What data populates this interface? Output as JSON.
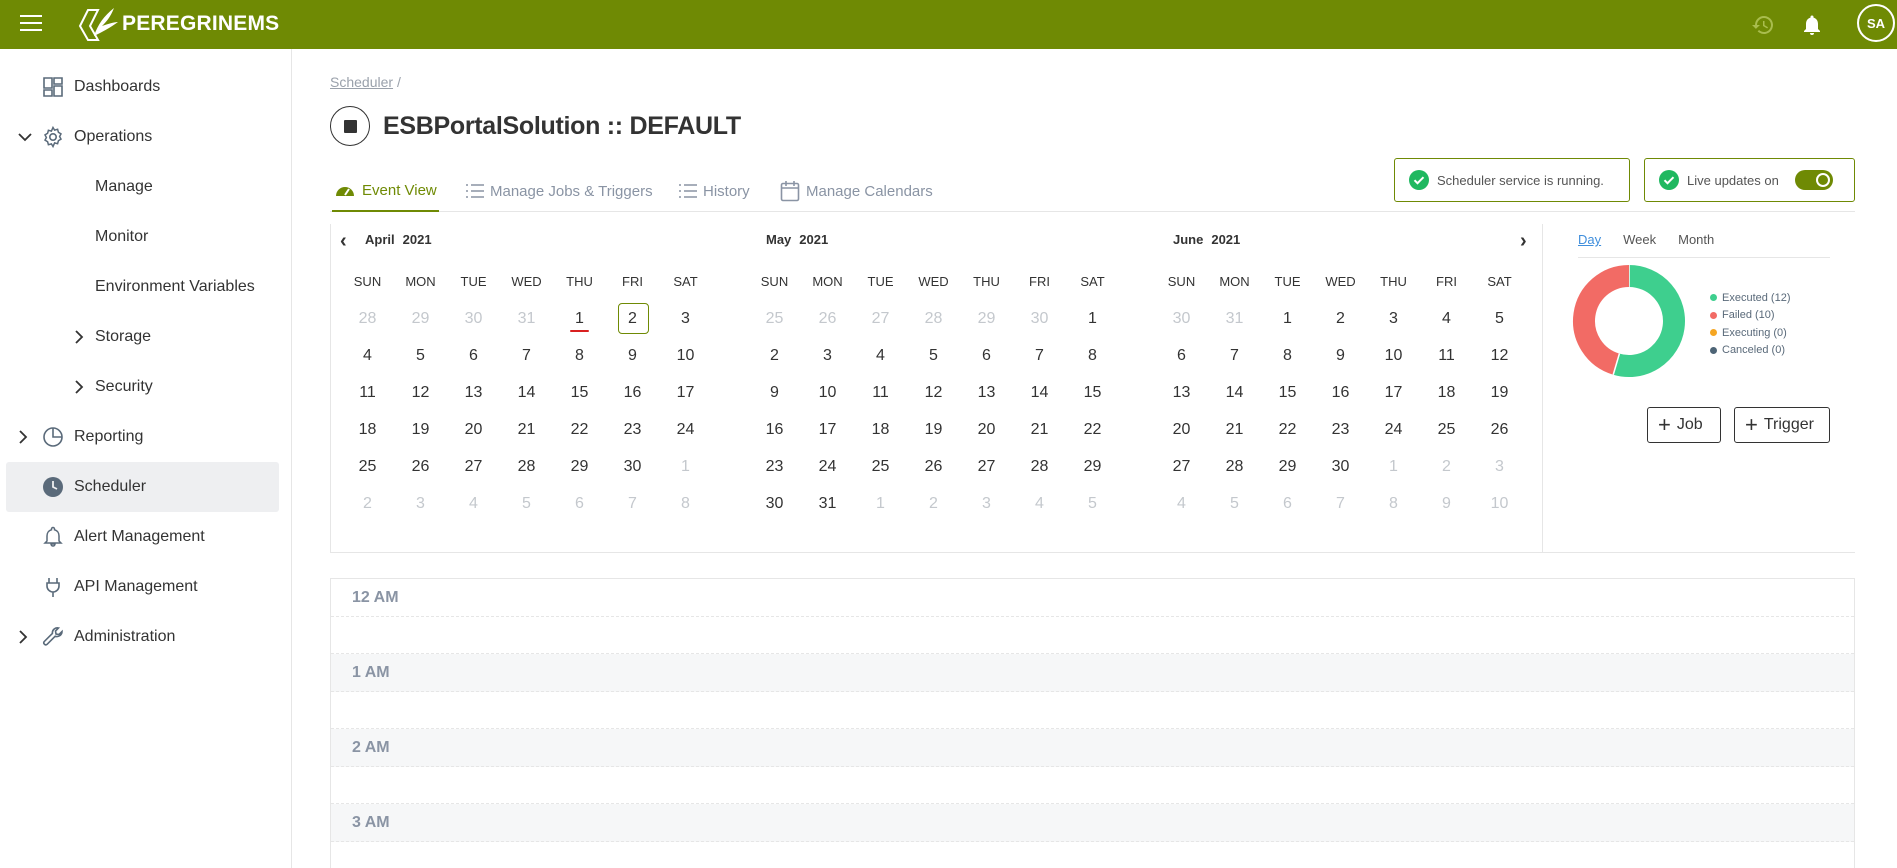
{
  "topbar": {
    "brand": "PEREGRINEMS",
    "avatar_initials": "SA",
    "icons": [
      "menu-icon",
      "history-icon",
      "bell-icon"
    ],
    "color": "#6f8a04"
  },
  "sidebar": {
    "items": [
      {
        "label": "Dashboards",
        "icon": "dashboard-icon"
      },
      {
        "label": "Operations",
        "icon": "gear-icon",
        "expanded": true
      },
      {
        "label": "Manage"
      },
      {
        "label": "Monitor"
      },
      {
        "label": "Environment Variables"
      },
      {
        "label": "Storage",
        "collapsed": true
      },
      {
        "label": "Security",
        "collapsed": true
      },
      {
        "label": "Reporting",
        "icon": "pie-icon",
        "collapsed": true
      },
      {
        "label": "Scheduler",
        "icon": "clock-icon",
        "active": true
      },
      {
        "label": "Alert Management",
        "icon": "bell-icon"
      },
      {
        "label": "API Management",
        "icon": "plug-icon"
      },
      {
        "label": "Administration",
        "icon": "wrench-icon",
        "collapsed": true
      }
    ]
  },
  "breadcrumb": {
    "link": "Scheduler",
    "separator": "/"
  },
  "page": {
    "title": "ESBPortalSolution :: DEFAULT"
  },
  "tabs": [
    {
      "label": "Event View",
      "active": true
    },
    {
      "label": "Manage Jobs & Triggers"
    },
    {
      "label": "History"
    },
    {
      "label": "Manage Calendars"
    }
  ],
  "status": {
    "service": "Scheduler service is running.",
    "live": "Live updates on",
    "live_on": true
  },
  "calendar": {
    "weekdays": [
      "SUN",
      "MON",
      "TUE",
      "WED",
      "THU",
      "FRI",
      "SAT"
    ],
    "months": [
      {
        "name": "April",
        "year": "2021",
        "days": [
          [
            "28",
            "29",
            "30",
            "31",
            "1",
            "2",
            "3"
          ],
          [
            "4",
            "5",
            "6",
            "7",
            "8",
            "9",
            "10"
          ],
          [
            "11",
            "12",
            "13",
            "14",
            "15",
            "16",
            "17"
          ],
          [
            "18",
            "19",
            "20",
            "21",
            "22",
            "23",
            "24"
          ],
          [
            "25",
            "26",
            "27",
            "28",
            "29",
            "30",
            "1"
          ],
          [
            "2",
            "3",
            "4",
            "5",
            "6",
            "7",
            "8"
          ]
        ],
        "first_in": 4,
        "last_in": 33,
        "today": 4,
        "selected": 5
      },
      {
        "name": "May",
        "year": "2021",
        "days": [
          [
            "25",
            "26",
            "27",
            "28",
            "29",
            "30",
            "1"
          ],
          [
            "2",
            "3",
            "4",
            "5",
            "6",
            "7",
            "8"
          ],
          [
            "9",
            "10",
            "11",
            "12",
            "13",
            "14",
            "15"
          ],
          [
            "16",
            "17",
            "18",
            "19",
            "20",
            "21",
            "22"
          ],
          [
            "23",
            "24",
            "25",
            "26",
            "27",
            "28",
            "29"
          ],
          [
            "30",
            "31",
            "1",
            "2",
            "3",
            "4",
            "5"
          ]
        ],
        "first_in": 6,
        "last_in": 36
      },
      {
        "name": "June",
        "year": "2021",
        "days": [
          [
            "30",
            "31",
            "1",
            "2",
            "3",
            "4",
            "5"
          ],
          [
            "6",
            "7",
            "8",
            "9",
            "10",
            "11",
            "12"
          ],
          [
            "13",
            "14",
            "15",
            "16",
            "17",
            "18",
            "19"
          ],
          [
            "20",
            "21",
            "22",
            "23",
            "24",
            "25",
            "26"
          ],
          [
            "27",
            "28",
            "29",
            "30",
            "1",
            "2",
            "3"
          ],
          [
            "4",
            "5",
            "6",
            "7",
            "8",
            "9",
            "10"
          ]
        ],
        "first_in": 2,
        "last_in": 31
      }
    ]
  },
  "range_tabs": [
    {
      "label": "Day",
      "active": true
    },
    {
      "label": "Week"
    },
    {
      "label": "Month"
    }
  ],
  "chart_data": {
    "type": "pie",
    "donut": true,
    "labels": [
      "Executed (12)",
      "Failed (10)",
      "Executing (0)",
      "Canceled (0)"
    ],
    "values": [
      12,
      10,
      0,
      0
    ],
    "colors": [
      "#3ecf8e",
      "#f26b65",
      "#f5a623",
      "#4d6476"
    ],
    "legend": "right"
  },
  "actions": {
    "job": "Job",
    "trigger": "Trigger"
  },
  "timegrid": {
    "hours": [
      "12 AM",
      "1 AM",
      "2 AM",
      "3 AM"
    ]
  }
}
